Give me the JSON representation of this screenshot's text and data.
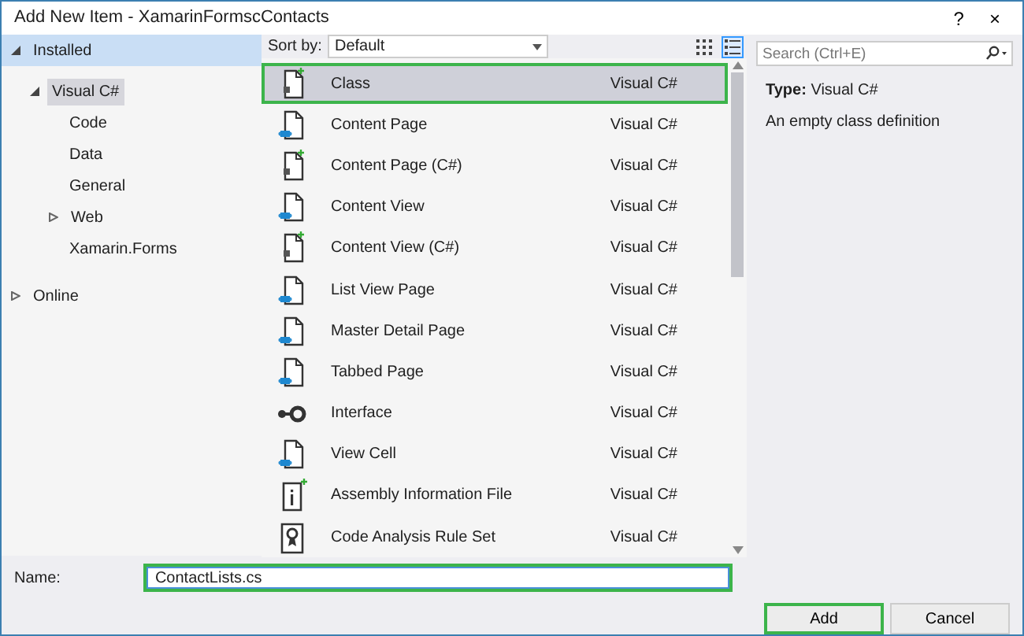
{
  "window": {
    "title": "Add New Item - XamarinFormscContacts",
    "help": "?",
    "close": "×"
  },
  "tree": [
    {
      "label": "Installed",
      "expanded": true,
      "selected": false,
      "children": [
        {
          "label": "Visual C#",
          "expanded": true,
          "selected": true,
          "children": [
            {
              "label": "Code",
              "selected": false
            },
            {
              "label": "Data",
              "selected": false
            },
            {
              "label": "General",
              "selected": false
            },
            {
              "label": "Web",
              "expanded": false,
              "selected": false
            },
            {
              "label": "Xamarin.Forms",
              "selected": false
            }
          ]
        }
      ]
    },
    {
      "label": "Online",
      "expanded": false,
      "selected": false
    }
  ],
  "sort": {
    "label": "Sort by:",
    "value": "Default"
  },
  "view_modes": [
    {
      "kind": "grid",
      "selected": false
    },
    {
      "kind": "list",
      "selected": true
    }
  ],
  "templates": [
    {
      "name": "Class",
      "type": "Visual C#",
      "kind": "code",
      "selected": true
    },
    {
      "name": "Content Page",
      "type": "Visual C#",
      "kind": "xaml",
      "selected": false
    },
    {
      "name": "Content Page (C#)",
      "type": "Visual C#",
      "kind": "code",
      "selected": false
    },
    {
      "name": "Content View",
      "type": "Visual C#",
      "kind": "xaml",
      "selected": false
    },
    {
      "name": "Content View (C#)",
      "type": "Visual C#",
      "kind": "code",
      "selected": false
    },
    {
      "name": "List View Page",
      "type": "Visual C#",
      "kind": "xaml",
      "selected": false
    },
    {
      "name": "Master Detail Page",
      "type": "Visual C#",
      "kind": "xaml",
      "selected": false
    },
    {
      "name": "Tabbed Page",
      "type": "Visual C#",
      "kind": "xaml",
      "selected": false
    },
    {
      "name": "Interface",
      "type": "Visual C#",
      "kind": "interface",
      "selected": false
    },
    {
      "name": "View Cell",
      "type": "Visual C#",
      "kind": "xaml",
      "selected": false
    },
    {
      "name": "Assembly Information File",
      "type": "Visual C#",
      "kind": "info",
      "selected": false
    },
    {
      "name": "Code Analysis Rule Set",
      "type": "Visual C#",
      "kind": "ruleset",
      "selected": false
    }
  ],
  "search": {
    "placeholder": "Search (Ctrl+E)"
  },
  "details": {
    "type_label": "Type:",
    "type_value": "Visual C#",
    "description": "An empty class definition"
  },
  "name_field": {
    "label": "Name:",
    "value": "ContactLists.cs",
    "highlighted": true
  },
  "buttons": [
    {
      "label": "Add",
      "highlighted": true
    },
    {
      "label": "Cancel",
      "highlighted": false
    }
  ]
}
